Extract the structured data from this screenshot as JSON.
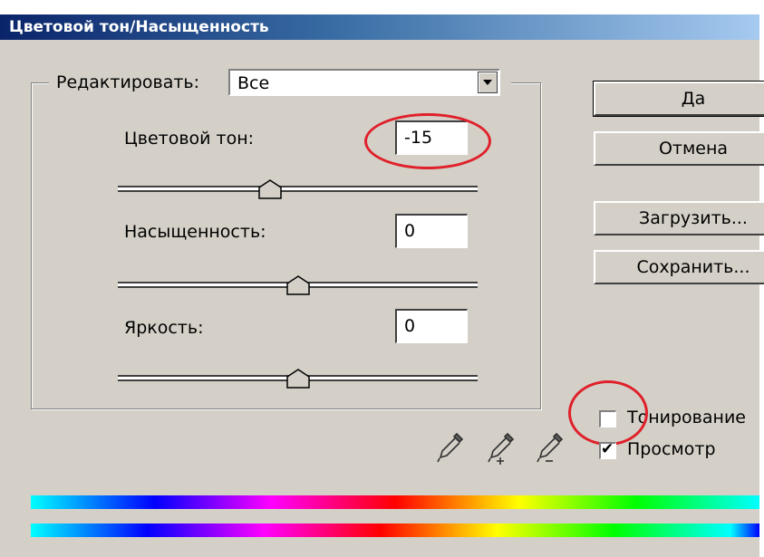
{
  "window": {
    "title": "Цветовой тон/Насыщенность"
  },
  "edit": {
    "label": "Редактировать:",
    "selected": "Все"
  },
  "hue": {
    "label": "Цветовой тон:",
    "value": "-15"
  },
  "saturation": {
    "label": "Насыщенность:",
    "value": "0"
  },
  "lightness": {
    "label": "Яркость:",
    "value": "0"
  },
  "buttons": {
    "ok": "Да",
    "cancel": "Отмена",
    "load": "Загрузить...",
    "save": "Сохранить..."
  },
  "options": {
    "colorize": {
      "label": "Тонирование",
      "checked": false
    },
    "preview": {
      "label": "Просмотр",
      "checked": true
    }
  },
  "icons": [
    "eyedropper-icon",
    "eyedropper-plus-icon",
    "eyedropper-minus-icon"
  ],
  "colors": {
    "title_start": "#0a246a",
    "title_end": "#a6caf0",
    "highlight_ring": "#e0202a",
    "dialog_bg": "#d4d0c8"
  }
}
